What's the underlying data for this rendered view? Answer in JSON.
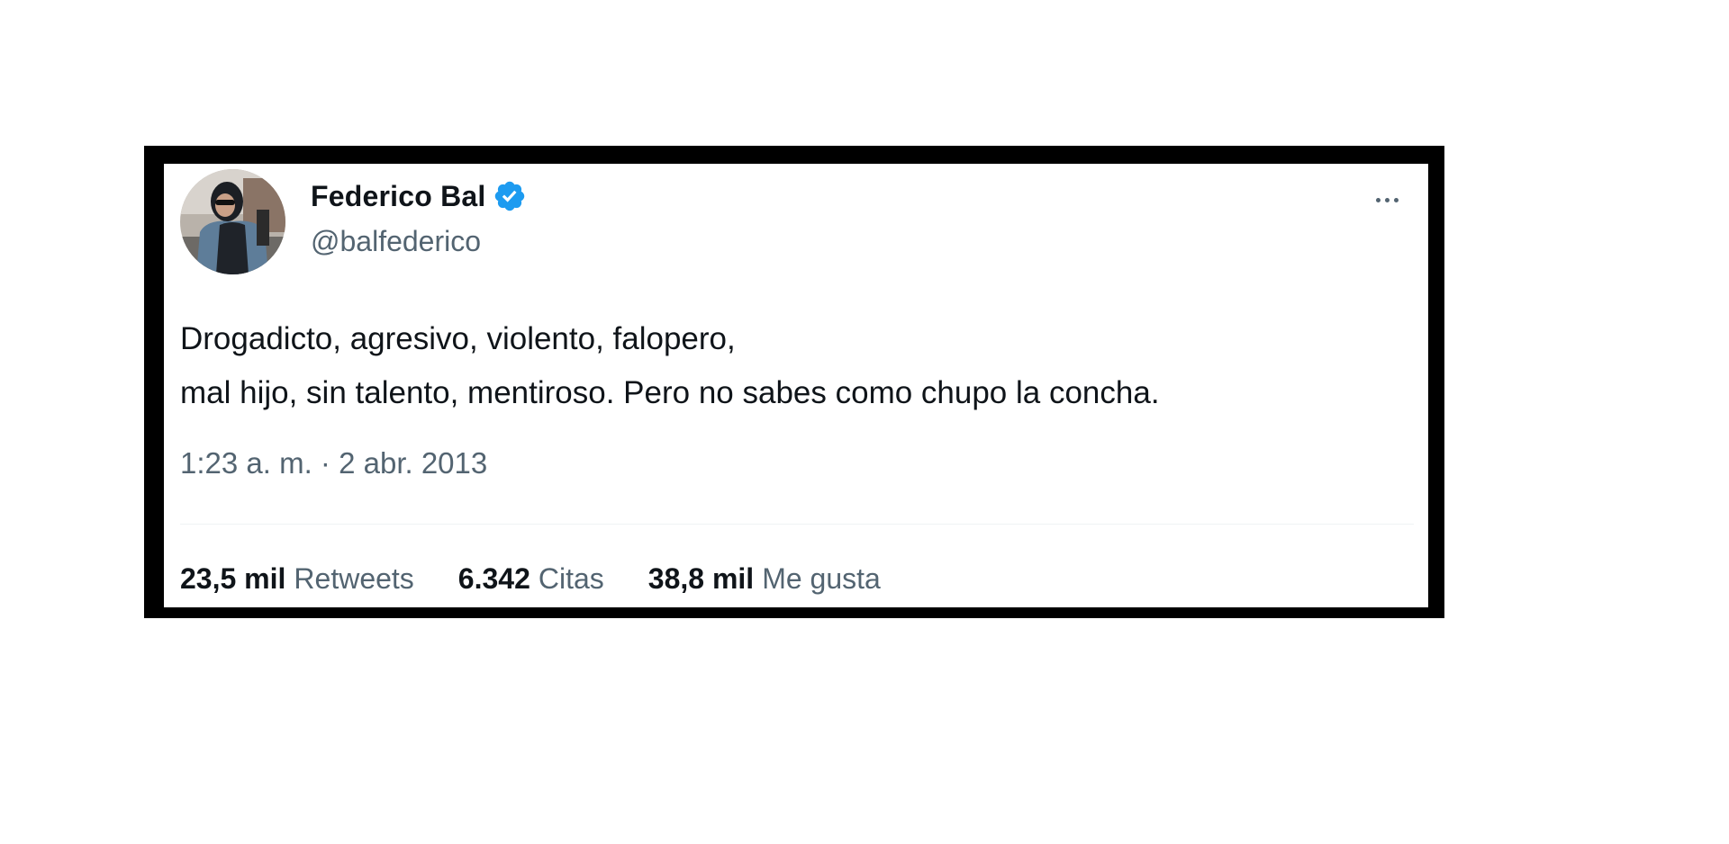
{
  "tweet": {
    "author": {
      "display_name": "Federico Bal",
      "handle": "@balfederico",
      "verified": true,
      "verified_color": "#1d9bf0"
    },
    "text_lines": [
      "Drogadicto, agresivo, violento, falopero,",
      "mal hijo, sin talento, mentiroso. Pero no sabes como chupo la concha."
    ],
    "time": "1:23 a. m.",
    "separator": "·",
    "date": "2 abr. 2013",
    "stats": [
      {
        "value": "23,5 mil",
        "label": "Retweets"
      },
      {
        "value": "6.342",
        "label": "Citas"
      },
      {
        "value": "38,8 mil",
        "label": "Me gusta"
      }
    ],
    "more_icon": "more-horizontal-icon"
  },
  "colors": {
    "frame": "#000000",
    "text_primary": "#0f1419",
    "text_secondary": "#536471",
    "divider": "#eff3f4"
  }
}
